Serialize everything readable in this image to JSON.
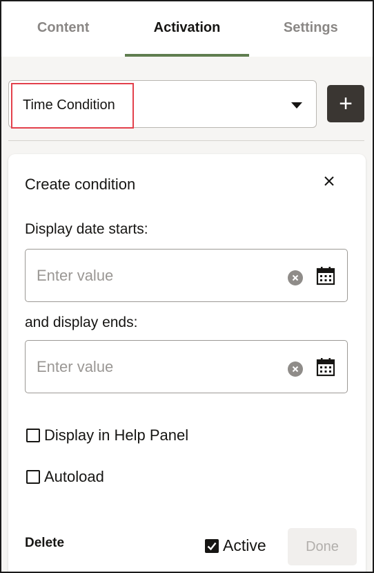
{
  "tabs": [
    {
      "label": "Content",
      "active": false
    },
    {
      "label": "Activation",
      "active": true
    },
    {
      "label": "Settings",
      "active": false
    }
  ],
  "condition_select": {
    "value": "Time Condition"
  },
  "add_button": {
    "label": "+"
  },
  "card": {
    "title": "Create condition",
    "start_label": "Display date starts:",
    "start_placeholder": "Enter value",
    "start_value": "",
    "end_label": "and display ends:",
    "end_placeholder": "Enter value",
    "end_value": "",
    "help_panel_label": "Display in Help Panel",
    "help_panel_checked": false,
    "autoload_label": "Autoload",
    "autoload_checked": false,
    "delete_label": "Delete",
    "active_label": "Active",
    "active_checked": true,
    "done_label": "Done"
  },
  "colors": {
    "accent": "#5f7d4f",
    "highlight": "#e3404b",
    "dark_button": "#3a3632"
  }
}
